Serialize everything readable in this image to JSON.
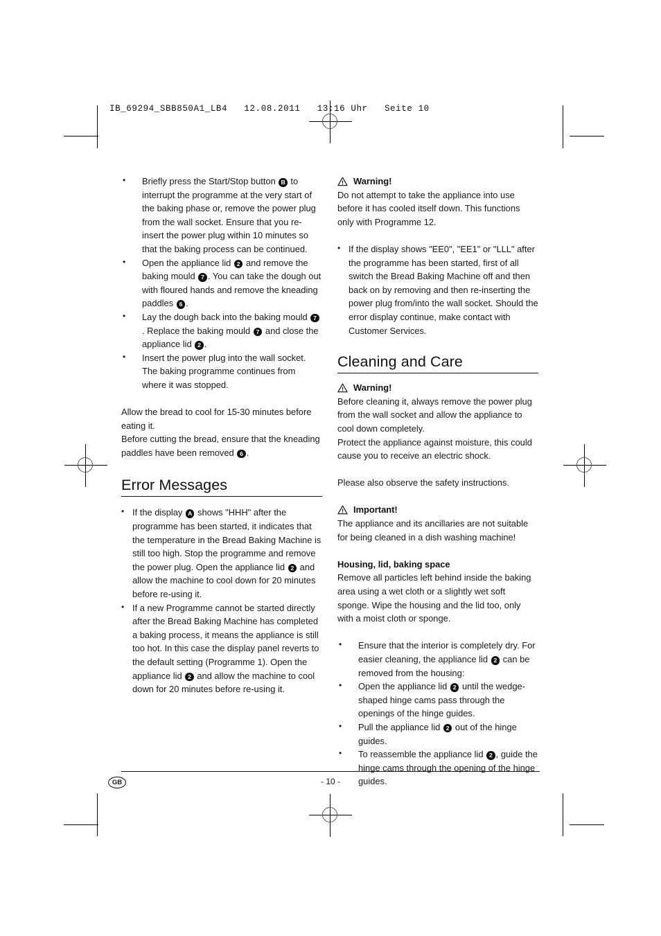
{
  "file_header": "IB_69294_SBB850A1_LB4   12.08.2011   13:16 Uhr   Seite 10",
  "left_column": {
    "bullets_top": [
      {
        "parts": [
          {
            "t": "text",
            "v": "Briefly press the Start/Stop button "
          },
          {
            "t": "ref",
            "v": "B"
          },
          {
            "t": "text",
            "v": " to interrupt the programme at the very start of the baking phase or, remove the power plug from the wall socket. Ensure that you re-insert the power plug within 10 minutes so that the baking process can be continued."
          }
        ]
      },
      {
        "parts": [
          {
            "t": "text",
            "v": "Open the appliance lid "
          },
          {
            "t": "ref",
            "v": "2"
          },
          {
            "t": "text",
            "v": " and remove the baking mould "
          },
          {
            "t": "ref",
            "v": "7"
          },
          {
            "t": "text",
            "v": ". You can take the dough out with floured hands and remove the kneading paddles "
          },
          {
            "t": "ref",
            "v": "6"
          },
          {
            "t": "text",
            "v": "."
          }
        ]
      },
      {
        "parts": [
          {
            "t": "text",
            "v": "Lay the dough back into the baking mould "
          },
          {
            "t": "ref",
            "v": "7"
          },
          {
            "t": "text",
            "v": ". Replace the baking mould "
          },
          {
            "t": "ref",
            "v": "7"
          },
          {
            "t": "text",
            "v": " and close the appliance lid "
          },
          {
            "t": "ref",
            "v": "2"
          },
          {
            "t": "text",
            "v": "."
          }
        ]
      },
      {
        "parts": [
          {
            "t": "text",
            "v": "Insert the power plug into the wall socket. The baking programme continues from where it was stopped."
          }
        ]
      }
    ],
    "paragraph_cool": {
      "parts": [
        {
          "t": "text",
          "v": "Allow the bread to cool for 15-30 minutes before eating it."
        }
      ]
    },
    "paragraph_cutting": {
      "parts": [
        {
          "t": "text",
          "v": "Before cutting the bread, ensure that the kneading paddles have been removed "
        },
        {
          "t": "ref",
          "v": "6"
        },
        {
          "t": "text",
          "v": "."
        }
      ]
    },
    "error_messages_heading": "Error Messages",
    "error_bullets": [
      {
        "parts": [
          {
            "t": "text",
            "v": "If the display "
          },
          {
            "t": "ref",
            "v": "A"
          },
          {
            "t": "text",
            "v": " shows \"HHH\" after the programme has been started, it indicates that the temperature in the Bread Baking Machine is still too high. Stop the programme and remove the power plug. Open the appliance lid "
          },
          {
            "t": "ref",
            "v": "2"
          },
          {
            "t": "text",
            "v": " and allow the machine to cool down for 20 minutes before re-using it."
          }
        ]
      },
      {
        "parts": [
          {
            "t": "text",
            "v": "If a new Programme cannot be started directly after the Bread Baking Machine has completed a baking process, it means the appliance is still too hot. In this case the display panel reverts to the default setting (Programme 1). Open the appliance lid "
          },
          {
            "t": "ref",
            "v": "2"
          },
          {
            "t": "text",
            "v": " and allow the machine to cool down for 20 minutes before re-using it."
          }
        ]
      }
    ]
  },
  "right_column": {
    "warning_label_1": "Warning!",
    "warning_body_1": {
      "parts": [
        {
          "t": "text",
          "v": "Do not attempt to take the appliance into use before it has cooled itself down. This functions only with Programme 12."
        }
      ]
    },
    "display_bullets": [
      {
        "parts": [
          {
            "t": "text",
            "v": "If the display shows \"EE0\", \"EE1\" or \"LLL\" after the programme has been started, first of all switch the Bread Baking Machine off and then back on by removing and then re-inserting the power plug from/into the wall socket. Should the error display continue, make contact with Customer Services."
          }
        ]
      }
    ],
    "cleaning_heading": "Cleaning and Care",
    "warning_label_2": "Warning!",
    "warning_body_2a": {
      "parts": [
        {
          "t": "text",
          "v": "Before cleaning it, always remove the power plug from the wall socket and allow the appliance to cool down completely."
        }
      ]
    },
    "warning_body_2b": {
      "parts": [
        {
          "t": "text",
          "v": "Protect the appliance against moisture, this could cause you to receive an electric shock."
        }
      ]
    },
    "safety_note": {
      "parts": [
        {
          "t": "text",
          "v": "Please also observe the safety instructions."
        }
      ]
    },
    "important_label": "Important!",
    "important_body": {
      "parts": [
        {
          "t": "text",
          "v": "The appliance and its ancillaries are not suitable for being cleaned in a dish washing machine!"
        }
      ]
    },
    "housing_subhead": "Housing, lid, baking space",
    "housing_body": {
      "parts": [
        {
          "t": "text",
          "v": "Remove all particles left behind inside the baking area using a wet cloth or a slightly wet soft sponge. Wipe the housing and the lid too, only with a moist cloth or sponge."
        }
      ]
    },
    "housing_bullets": [
      {
        "parts": [
          {
            "t": "text",
            "v": "Ensure that the interior is completely dry. For easier cleaning, the appliance lid "
          },
          {
            "t": "ref",
            "v": "2"
          },
          {
            "t": "text",
            "v": " can be removed from the housing:"
          }
        ]
      },
      {
        "parts": [
          {
            "t": "text",
            "v": "Open the appliance lid "
          },
          {
            "t": "ref",
            "v": "2"
          },
          {
            "t": "text",
            "v": " until the wedge-shaped hinge cams pass through the openings of the hinge guides."
          }
        ]
      },
      {
        "parts": [
          {
            "t": "text",
            "v": "Pull the appliance lid "
          },
          {
            "t": "ref",
            "v": "2"
          },
          {
            "t": "text",
            "v": " out of the hinge guides."
          }
        ]
      },
      {
        "parts": [
          {
            "t": "text",
            "v": "To reassemble the appliance lid "
          },
          {
            "t": "ref",
            "v": "2"
          },
          {
            "t": "text",
            "v": ", guide the hinge cams through the opening of the hinge guides."
          }
        ]
      }
    ]
  },
  "footer": {
    "locale_badge": "GB",
    "page_number": "- 10 -"
  },
  "colors": {
    "text": "#1a1a1a",
    "rule": "#111111",
    "marker_fill": "#111111",
    "marker_text": "#ffffff",
    "page_background": "#ffffff"
  }
}
